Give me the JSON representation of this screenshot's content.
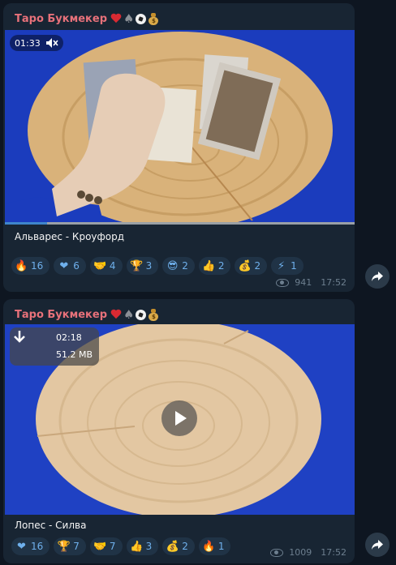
{
  "posts": [
    {
      "channel": "Таро Букмекер",
      "title_emoji": [
        "heart",
        "spade",
        "soccer-ball",
        "money-bag"
      ],
      "video": {
        "time": "01:33",
        "muted": true,
        "progress_fraction": 0.12
      },
      "caption": "Альварес - Кроуфорд",
      "reactions": [
        {
          "emoji": "fire",
          "glyph": "🔥",
          "count": "16"
        },
        {
          "emoji": "heart-on-fire",
          "glyph": "❤",
          "count": "6"
        },
        {
          "emoji": "handshake",
          "glyph": "🤝",
          "count": "4"
        },
        {
          "emoji": "trophy",
          "glyph": "🏆",
          "count": "3"
        },
        {
          "emoji": "cool-face",
          "glyph": "😎",
          "count": "2"
        },
        {
          "emoji": "thumbs-up",
          "glyph": "👍",
          "count": "2"
        },
        {
          "emoji": "money-bag",
          "glyph": "💰",
          "count": "2"
        },
        {
          "emoji": "lightning",
          "glyph": "⚡",
          "count": "1"
        }
      ],
      "views": "941",
      "time": "17:52"
    },
    {
      "channel": "Таро Букмекер",
      "title_emoji": [
        "heart",
        "spade",
        "soccer-ball",
        "money-bag"
      ],
      "video": {
        "duration": "02:18",
        "size": "51.2 MB"
      },
      "caption": "Лопес - Силва",
      "reactions": [
        {
          "emoji": "heart-on-fire",
          "glyph": "❤",
          "count": "16"
        },
        {
          "emoji": "trophy",
          "glyph": "🏆",
          "count": "7"
        },
        {
          "emoji": "handshake",
          "glyph": "🤝",
          "count": "7"
        },
        {
          "emoji": "thumbs-up",
          "glyph": "👍",
          "count": "3"
        },
        {
          "emoji": "money-bag",
          "glyph": "💰",
          "count": "2"
        },
        {
          "emoji": "fire",
          "glyph": "🔥",
          "count": "1"
        }
      ],
      "views": "1009",
      "time": "17:52"
    }
  ],
  "colors": {
    "background": "#0e1621",
    "bubble": "#182533",
    "channel_name": "#e7717a",
    "reaction_text": "#6fb0ec",
    "meta": "#6d7f8f"
  }
}
